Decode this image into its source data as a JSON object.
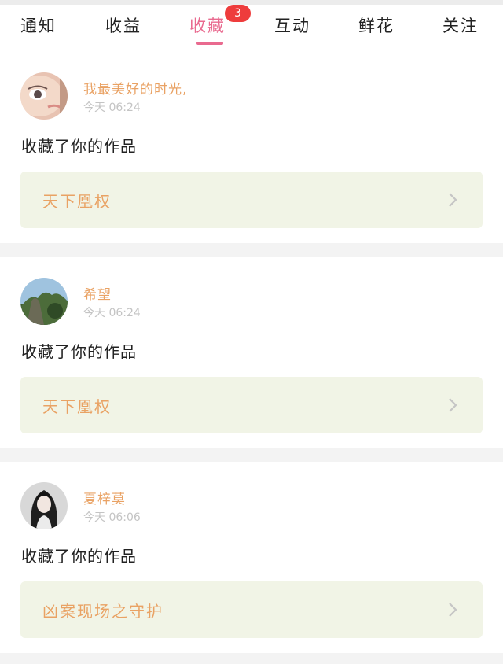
{
  "tabs": [
    {
      "label": "通知"
    },
    {
      "label": "收益"
    },
    {
      "label": "收藏",
      "badge": "3",
      "active": true
    },
    {
      "label": "互动"
    },
    {
      "label": "鲜花"
    },
    {
      "label": "关注"
    }
  ],
  "colors": {
    "accent": "#e96a8f",
    "badge": "#ee3c3c",
    "username": "#e9a264",
    "work_card_bg": "#f1f4e6"
  },
  "notifications": [
    {
      "user": "我最美好的时光,",
      "time": "今天 06:24",
      "action": "收藏了你的作品",
      "work": "天下凰权"
    },
    {
      "user": "希望",
      "time": "今天 06:24",
      "action": "收藏了你的作品",
      "work": "天下凰权"
    },
    {
      "user": "夏梓莫",
      "time": "今天 06:06",
      "action": "收藏了你的作品",
      "work": "凶案现场之守护"
    }
  ]
}
